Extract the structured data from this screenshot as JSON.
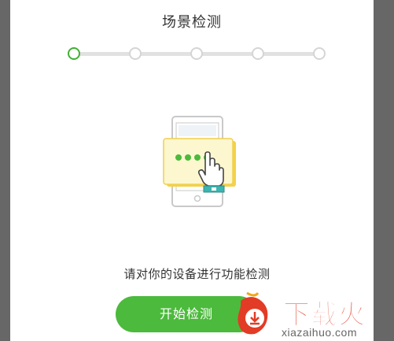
{
  "dialog": {
    "title": "场景检测",
    "steps_total": 5,
    "current_step": 1,
    "prompt": "请对你的设备进行功能检测",
    "start_button_label": "开始检测"
  },
  "illustration": {
    "icon": "phone-password-touch-icon",
    "colors": {
      "accent_green": "#4cba3c",
      "card_yellow": "#fdf6c4",
      "phone_outline": "#c8c8c8"
    }
  },
  "watermark": {
    "brand": "下载火",
    "domain": "xiazaihuo.com",
    "color": "#e23b26"
  }
}
